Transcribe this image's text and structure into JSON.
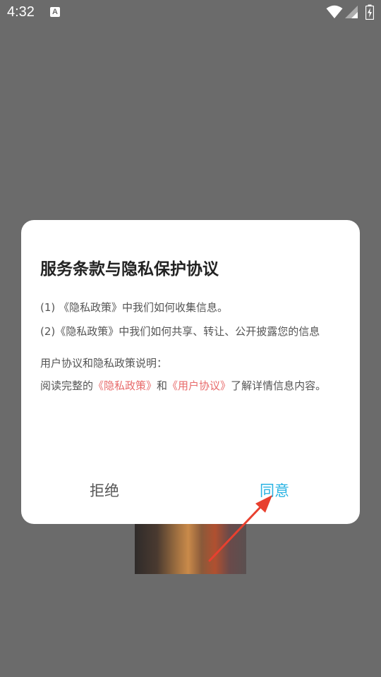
{
  "status_bar": {
    "time": "4:32",
    "notification_icon_letter": "A",
    "icons": [
      "wifi-icon",
      "signal-icon",
      "battery-icon"
    ]
  },
  "dialog": {
    "title": "服务条款与隐私保护协议",
    "item1": "(1) 《隐私政策》中我们如何收集信息。",
    "item2": "(2)《隐私政策》中我们如何共享、转让、公开披露您的信息",
    "note_heading": "用户协议和隐私政策说明：",
    "read_prefix": "阅读完整的",
    "privacy_link": "《隐私政策》",
    "and_text": "和",
    "user_agreement_link": "《用户协议》",
    "read_suffix": "了解详情信息内容。",
    "reject_label": "拒绝",
    "agree_label": "同意"
  },
  "colors": {
    "overlay": "#6b6b6b",
    "link": "#e86a6a",
    "agree": "#29b3e3",
    "arrow": "#e8402f"
  }
}
